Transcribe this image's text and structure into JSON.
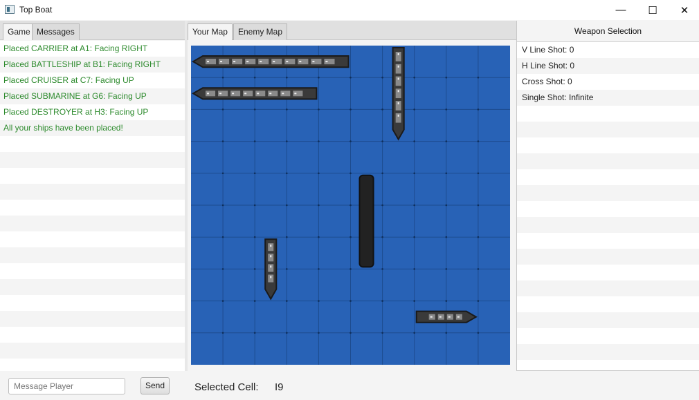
{
  "window": {
    "title": "Top Boat",
    "minimize_glyph": "—",
    "maximize_glyph": "☐",
    "close_glyph": "✕"
  },
  "left_tabs": [
    {
      "label": "Game",
      "active": true
    },
    {
      "label": "Messages",
      "active": false
    }
  ],
  "game_log": [
    "Placed CARRIER at A1: Facing RIGHT",
    "Placed BATTLESHIP at B1: Facing RIGHT",
    "Placed CRUISER at C7: Facing UP",
    "Placed SUBMARINE at G6: Facing UP",
    "Placed DESTROYER at H3: Facing UP",
    "All your ships have been placed!"
  ],
  "message_input": {
    "placeholder": "Message Player",
    "value": ""
  },
  "send_label": "Send",
  "map_tabs": [
    {
      "label": "Your Map",
      "active": true
    },
    {
      "label": "Enemy Map",
      "active": false
    }
  ],
  "map": {
    "grid_size": 10,
    "water_color": "#2862b6",
    "ships": [
      {
        "name": "CARRIER",
        "col": 0,
        "row": 0,
        "length": 5,
        "facing": "RIGHT"
      },
      {
        "name": "BATTLESHIP",
        "col": 0,
        "row": 1,
        "length": 4,
        "facing": "RIGHT"
      },
      {
        "name": "CRUISER",
        "col": 6,
        "row": 0,
        "length": 3,
        "facing": "UP"
      },
      {
        "name": "SUBMARINE",
        "col": 5,
        "row": 4,
        "length": 3,
        "facing": "UP"
      },
      {
        "name": "DESTROYER",
        "col": 2,
        "row": 6,
        "length": 2,
        "facing": "UP"
      },
      {
        "name": "DESTROYER-2",
        "col": 7,
        "row": 8,
        "length": 2,
        "facing": "RIGHT"
      }
    ]
  },
  "status": {
    "label": "Selected Cell:",
    "value": "I9"
  },
  "weapons": {
    "header": "Weapon Selection",
    "items": [
      "V Line Shot: 0",
      "H Line Shot: 0",
      "Cross Shot: 0",
      "Single Shot: Infinite"
    ]
  }
}
